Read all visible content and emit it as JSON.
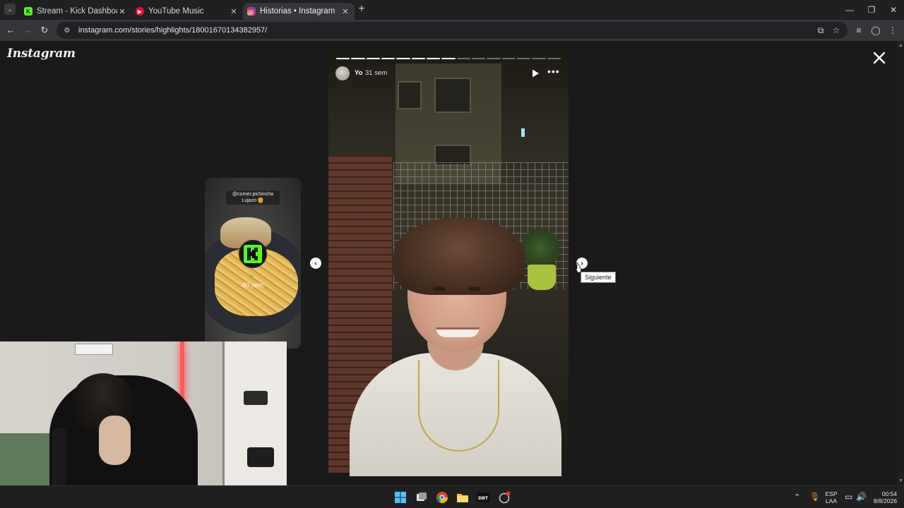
{
  "browser": {
    "tabs": [
      {
        "title": "Stream - Kick Dashboard",
        "favicon": "kick-icon",
        "color": "#53fc18",
        "active": false
      },
      {
        "title": "YouTube Music",
        "favicon": "youtube-music-icon",
        "color": "#ff0033",
        "active": false
      },
      {
        "title": "Historias • Instagram",
        "favicon": "instagram-icon",
        "color": "#d62976",
        "active": true
      }
    ],
    "url": "instagram.com/stories/highlights/18001670134382957/"
  },
  "page": {
    "logo": "Instagram",
    "preview": {
      "caption_line1": "@corner.pichincha",
      "caption_line2": "Lujazo 🍔",
      "time": "80 sem"
    },
    "story": {
      "username": "Yo",
      "time": "31 sem",
      "segments_total": 15,
      "segments_done": 8
    },
    "tooltip": "Siguiente"
  },
  "taskbar": {
    "lang_line1": "ESP",
    "lang_line2": "LAA",
    "time": "00:54",
    "date": "8/8/2026"
  }
}
